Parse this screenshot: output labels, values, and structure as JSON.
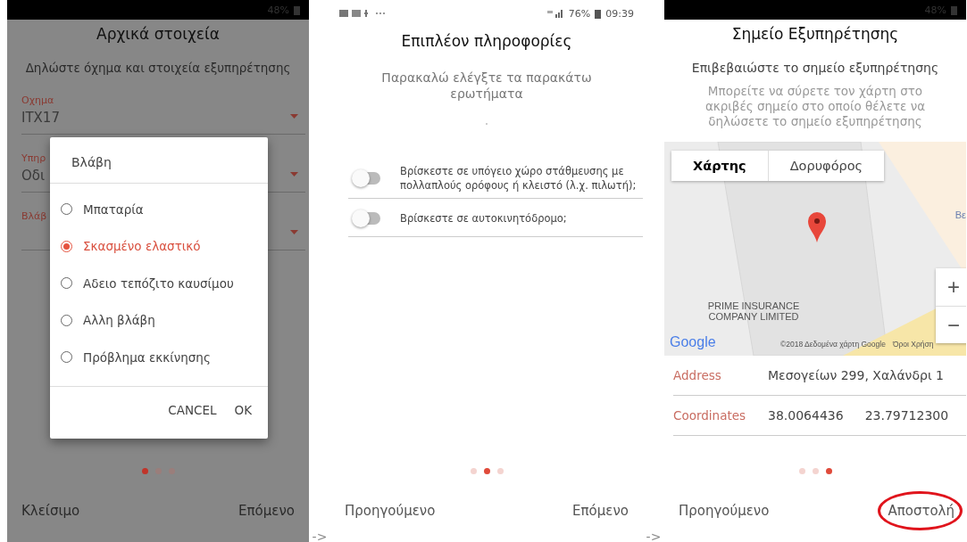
{
  "screens": [
    {
      "kind": "dialog_form",
      "status_bar": {
        "battery": "48%"
      },
      "title": "Αρχικά στοιχεία",
      "subtitle": "Δηλώστε όχημα και στοιχεία εξυπηρέτησης",
      "fields": [
        {
          "label": "Οχημα",
          "value": "ITX17"
        },
        {
          "label": "Υπηρ",
          "value": "Οδι"
        },
        {
          "label": "Βλάβ"
        }
      ],
      "dialog": {
        "title": "Βλάβη",
        "options": [
          {
            "label": "Μπαταρία",
            "selected": false
          },
          {
            "label": "Σκασμένο ελαστικό",
            "selected": true
          },
          {
            "label": "Αδειο τεπόζιτο καυσίμου",
            "selected": false
          },
          {
            "label": "Αλλη βλάβη",
            "selected": false
          },
          {
            "label": "Πρόβλημα εκκίνησης",
            "selected": false
          }
        ],
        "buttons": [
          "CANCEL",
          "OK"
        ]
      },
      "pager": [
        {
          "selected": true
        },
        {
          "selected": false
        },
        {
          "selected": false
        }
      ],
      "buttons": [
        {
          "label": "Κλείσιμο",
          "highlighted": false
        },
        {
          "label": "Επόμενο",
          "highlighted": false
        }
      ]
    },
    {
      "kind": "questions",
      "status_bar": {
        "battery": "76%",
        "time": "09:39"
      },
      "title": "Επιπλέον πληροφορίες",
      "subtitle": "Παρακαλώ ελέγξτε τα παρακάτω ερωτήματα",
      "questions": [
        {
          "label": "Βρίσκεστε σε υπόγειο χώρο στάθμευσης με πολλαπλούς ορόφους ή κλειστό (λ.χ. πιλωτή);",
          "on": false
        },
        {
          "label": "Βρίσκεστε σε αυτοκινητόδρομο;",
          "on": false
        }
      ],
      "pager": [
        {
          "selected": false
        },
        {
          "selected": true
        },
        {
          "selected": false
        }
      ],
      "buttons": [
        {
          "label": "Προηγούμενο",
          "highlighted": false
        },
        {
          "label": "Επόμενο",
          "highlighted": false
        }
      ]
    },
    {
      "kind": "map",
      "status_bar": {
        "battery": "48%"
      },
      "title": "Σημείο Εξυπηρέτησης",
      "subtitle": "Επιβεβαιώστε το σημείο εξυπηρέτησης",
      "hint": "Μπορείτε να σύρετε τον χάρτη στο ακριβές σημείο στο οποίο θέλετε να δηλώσετε το σημείο εξυπηρέτησης",
      "map": {
        "tabs": [
          {
            "label": "Χάρτης",
            "selected": true
          },
          {
            "label": "Δορυφόρος",
            "selected": false
          }
        ],
        "place_label": "PRIME INSURANCE COMPANY LIMITED",
        "edge_label": "Βε",
        "logo": "Google",
        "attribution": "©2018 Δεδομένα χάρτη Google",
        "terms": "Όροι Χρήση",
        "zoom": [
          "+",
          "−"
        ]
      },
      "details": [
        {
          "label": "Address",
          "values": [
            "Μεσογείων 299, Χαλάνδρι 1"
          ]
        },
        {
          "label": "Coordinates",
          "values": [
            "38.0064436",
            "23.79712300"
          ]
        }
      ],
      "pager": [
        {
          "selected": false
        },
        {
          "selected": false
        },
        {
          "selected": true
        }
      ],
      "buttons": [
        {
          "label": "Προηγούμενο",
          "highlighted": false
        },
        {
          "label": "Αποστολή",
          "highlighted": true
        }
      ]
    }
  ],
  "arrows": [
    "->",
    "->"
  ]
}
